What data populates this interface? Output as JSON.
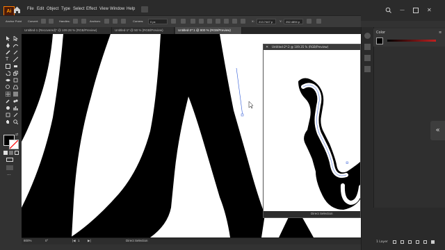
{
  "app": {
    "logo_text": "Ai"
  },
  "menu": [
    "File",
    "Edit",
    "Object",
    "Type",
    "Select",
    "Effect",
    "View",
    "Window",
    "Help"
  ],
  "control_bar": {
    "tool_name": "Anchor Point",
    "convert_label": "Convert:",
    "handles_label": "Handles:",
    "anchors_label": "Anchors:",
    "corners_label": "Corners:",
    "corners_value": "0 px",
    "x_label": "X:",
    "x_value": "213.7447 p",
    "y_label": "Y:",
    "y_value": "252.4894 p"
  },
  "tabs": [
    {
      "label": "Untitled-1 (Recovered)* @ 109.28 % (RGB/Preview)",
      "active": false
    },
    {
      "label": "Untitled-1* @ 50 % (RGB/Preview)",
      "active": false
    },
    {
      "label": "Untitled-2*:1 @ 800 % (RGB/Preview)",
      "active": true
    }
  ],
  "floating_window": {
    "title": "Untitled-2*:2 @ 109.35 % (RGB/Preview)"
  },
  "color_panel": {
    "title": "Color"
  },
  "status_bar": {
    "zoom": "800%",
    "rotation": "0°",
    "artboard": "1",
    "tool": "Direct Selection"
  },
  "float_status": {
    "tool": "Direct Selection"
  },
  "layers": {
    "count": "1 Layer"
  },
  "colors": {
    "accent": "#ff7c00",
    "canvas": "#ffffff",
    "chrome": "#323232",
    "path": "#2b57d6"
  }
}
